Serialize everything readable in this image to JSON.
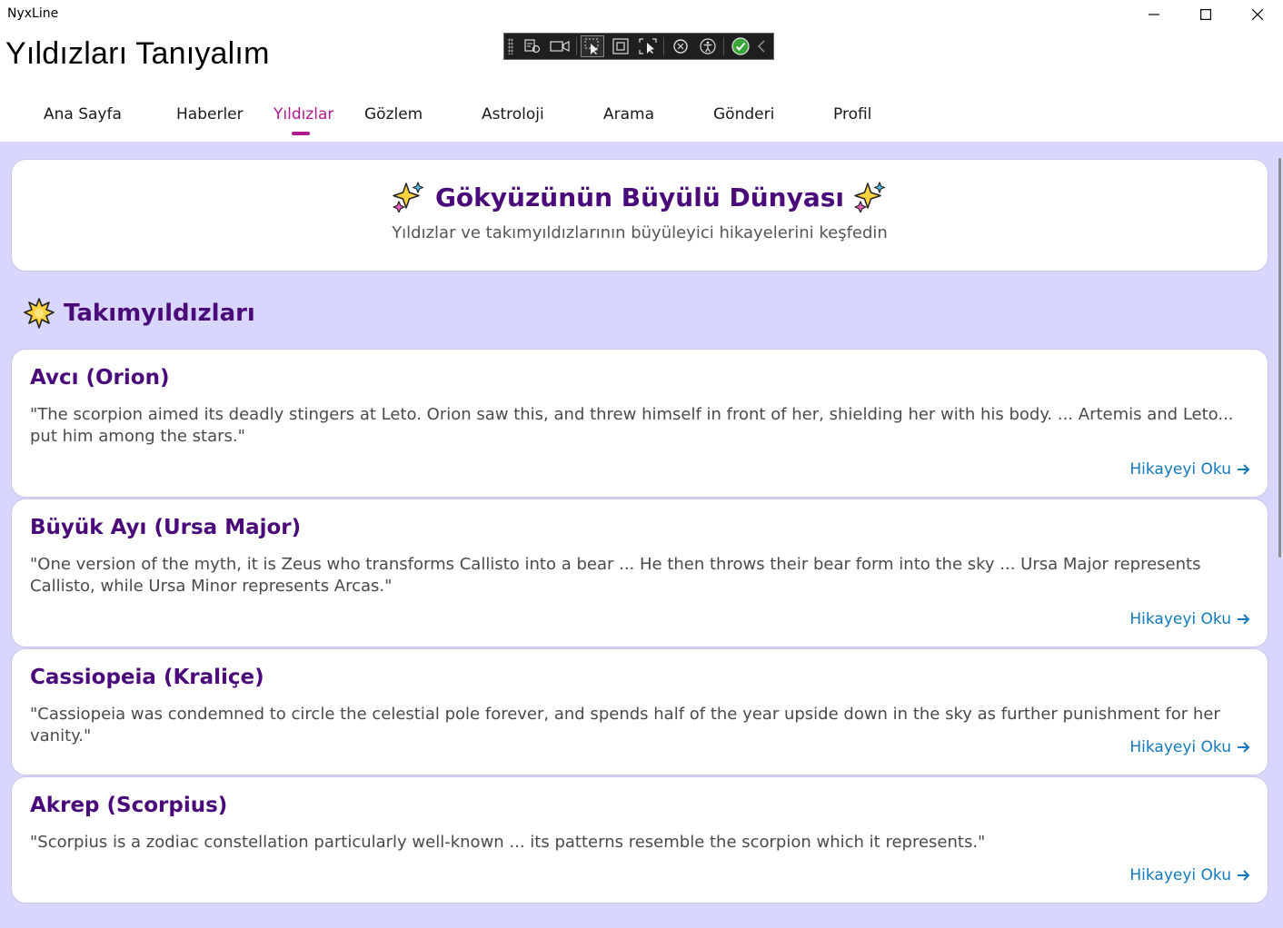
{
  "window": {
    "app_name": "NyxLine"
  },
  "page": {
    "title": "Yıldızları Tanıyalım"
  },
  "nav": {
    "items": [
      {
        "label": "Ana Sayfa"
      },
      {
        "label": "Haberler"
      },
      {
        "label": "Yıldızlar"
      },
      {
        "label": "Gözlem"
      },
      {
        "label": "Astroloji"
      },
      {
        "label": "Arama"
      },
      {
        "label": "Gönderi"
      },
      {
        "label": "Profil"
      }
    ],
    "active_index": 2
  },
  "hero": {
    "title": "Gökyüzünün Büyülü Dünyası",
    "subtitle": "Yıldızlar ve takımyıldızlarının büyüleyici hikayelerini keşfedin",
    "icon": "sparkles-icon"
  },
  "section": {
    "title": "Takımyıldızları",
    "icon": "star-icon"
  },
  "cards": [
    {
      "title": "Avcı (Orion)",
      "quote": "\"The scorpion aimed its deadly stingers at Leto. Orion saw this, and threw himself in front of her, shielding her with his body. ... Artemis and Leto... put him among the stars.\"",
      "link": "Hikayeyi Oku"
    },
    {
      "title": "Büyük Ayı (Ursa Major)",
      "quote": "\"One version of the myth, it is Zeus who transforms Callisto into a bear ... He then throws their bear form into the sky ... Ursa Major represents Callisto, while Ursa Minor represents Arcas.\"",
      "link": "Hikayeyi Oku"
    },
    {
      "title": "Cassiopeia (Kraliçe)",
      "quote": "\"Cassiopeia was condemned to circle the celestial pole forever, and spends half of the year upside down in the sky as further punishment for her vanity.\"",
      "link": "Hikayeyi Oku"
    },
    {
      "title": "Akrep (Scorpius)",
      "quote": "\"Scorpius is a zodiac constellation particularly well-known ... its patterns resemble the scorpion which it represents.\"",
      "link": "Hikayeyi Oku"
    }
  ],
  "colors": {
    "accent": "#b01a8e",
    "heading": "#4a0a7a",
    "link": "#1279bd",
    "background": "#d9d6fd"
  }
}
